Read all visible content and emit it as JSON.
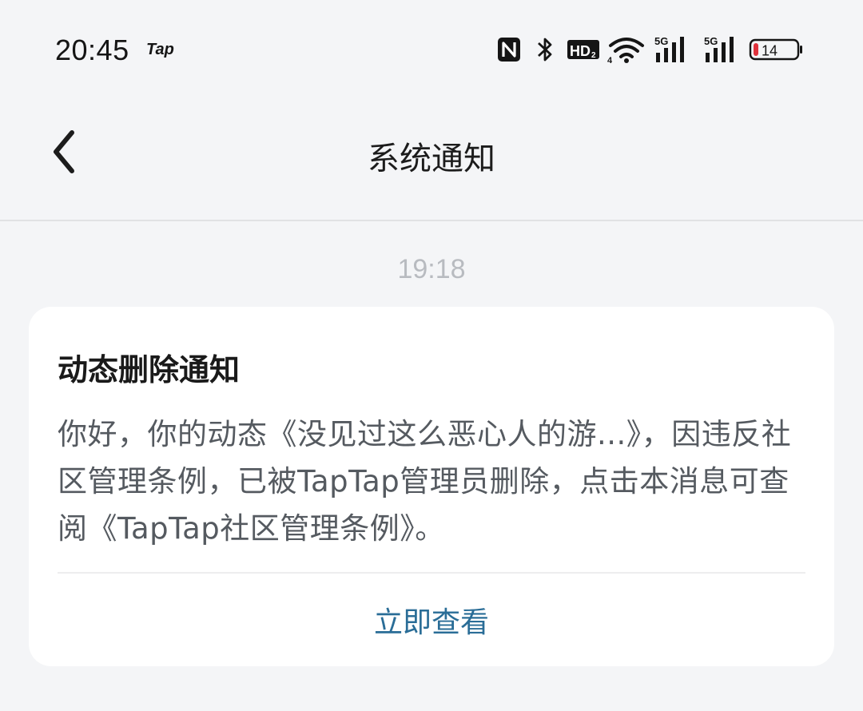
{
  "status_bar": {
    "time": "20:45",
    "app_indicator": "Tap",
    "icons": [
      "nfc-icon",
      "bluetooth-icon",
      "hd-icon",
      "wifi-icon",
      "signal-5g-icon",
      "signal-5g-icon",
      "battery-icon"
    ],
    "hd_label": "HD",
    "hd_sub": "2",
    "network_label_1": "5G",
    "network_label_2": "5G",
    "battery_level": "14",
    "battery_color": "#e0323c"
  },
  "header": {
    "back_icon": "chevron-left-icon",
    "title": "系统通知"
  },
  "message": {
    "time": "19:18",
    "card": {
      "title": "动态删除通知",
      "body": "你好，你的动态《没见过这么恶心人的游...》，因违反社区管理条例，已被TapTap管理员删除，点击本消息可查阅《TapTap社区管理条例》。",
      "action_label": "立即查看"
    }
  },
  "colors": {
    "background": "#f4f5f7",
    "card": "#ffffff",
    "accent": "#2a6d97",
    "body_text": "#555a60",
    "timestamp": "#b8bbc0"
  }
}
